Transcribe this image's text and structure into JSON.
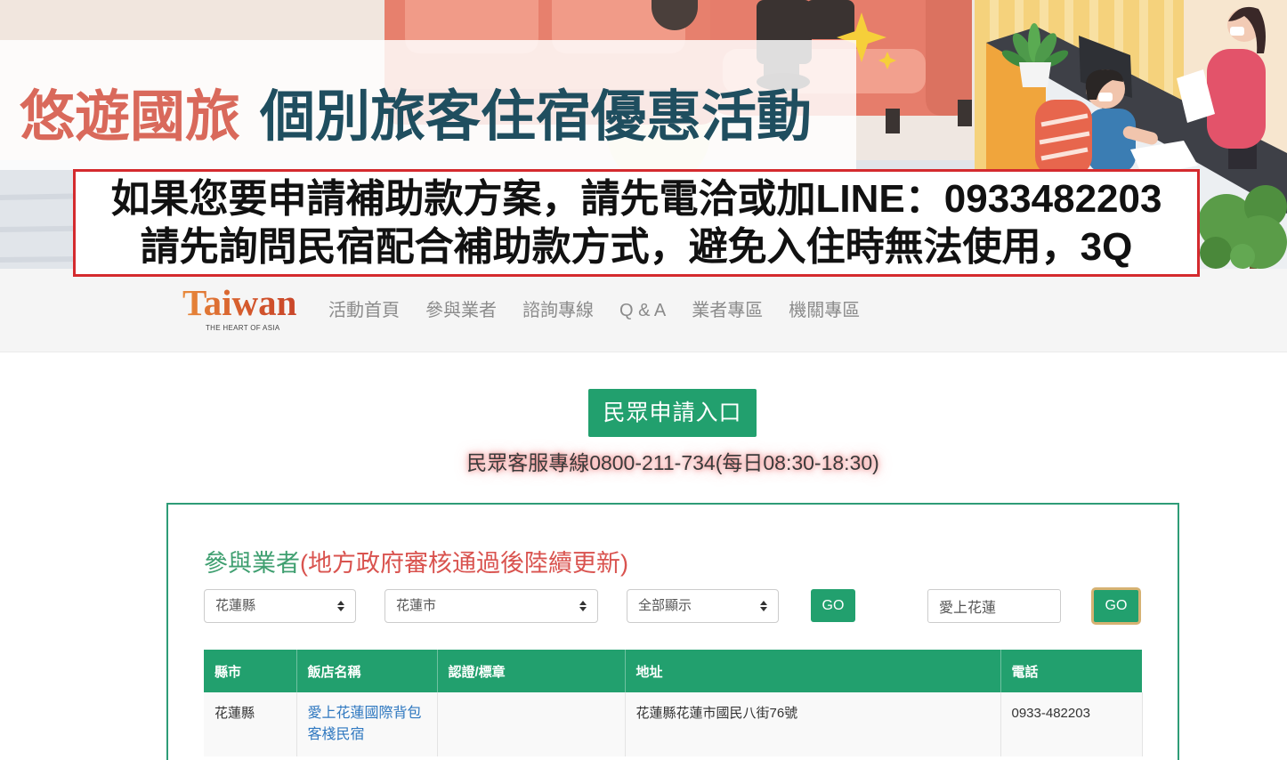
{
  "banner": {
    "title_highlight": "悠遊國旅",
    "title_main": "個別旅客住宿優惠活動",
    "notice_line1": "如果您要申請補助款方案，請先電洽或加LINE：0933482203",
    "notice_line2": "請先詢問民宿配合補助款方式，避免入住時無法使用，3Q"
  },
  "nav": {
    "logo_text": "Taiwan",
    "logo_tagline": "THE HEART OF ASIA",
    "items": [
      {
        "label": "活動首頁"
      },
      {
        "label": "參與業者"
      },
      {
        "label": "諮詢專線"
      },
      {
        "label": "Q & A"
      },
      {
        "label": "業者專區"
      },
      {
        "label": "機關專區"
      }
    ]
  },
  "apply_button_label": "民眾申請入口",
  "hotline_text": "民眾客服專線0800-211-734(每日08:30-18:30)",
  "participants": {
    "heading": "參與業者",
    "heading_note": "(地方政府審核通過後陸續更新)",
    "filters": {
      "county": "花蓮縣",
      "city": "花蓮市",
      "display": "全部顯示",
      "go_label": "GO",
      "search_value": "愛上花蓮",
      "search_go_label": "GO"
    },
    "table": {
      "columns": [
        "縣市",
        "飯店名稱",
        "認證/標章",
        "地址",
        "電話"
      ],
      "rows": [
        {
          "county": "花蓮縣",
          "name": "愛上花蓮國際背包客棧民宿",
          "certification": "",
          "address": "花蓮縣花蓮市國民八街76號",
          "phone": "0933-482203"
        }
      ]
    }
  },
  "icons": {
    "select_arrow": "sort-arrows-icon",
    "banner_sparkle": "sparkle-star-icon"
  },
  "colors": {
    "brand_green": "#22a06e",
    "heading_green": "#3f9f70",
    "title_red": "#d9695b",
    "title_teal": "#1f4e5f",
    "notice_border": "#d42a2e",
    "note_red": "#d9534f",
    "link_blue": "#2f78c0"
  }
}
